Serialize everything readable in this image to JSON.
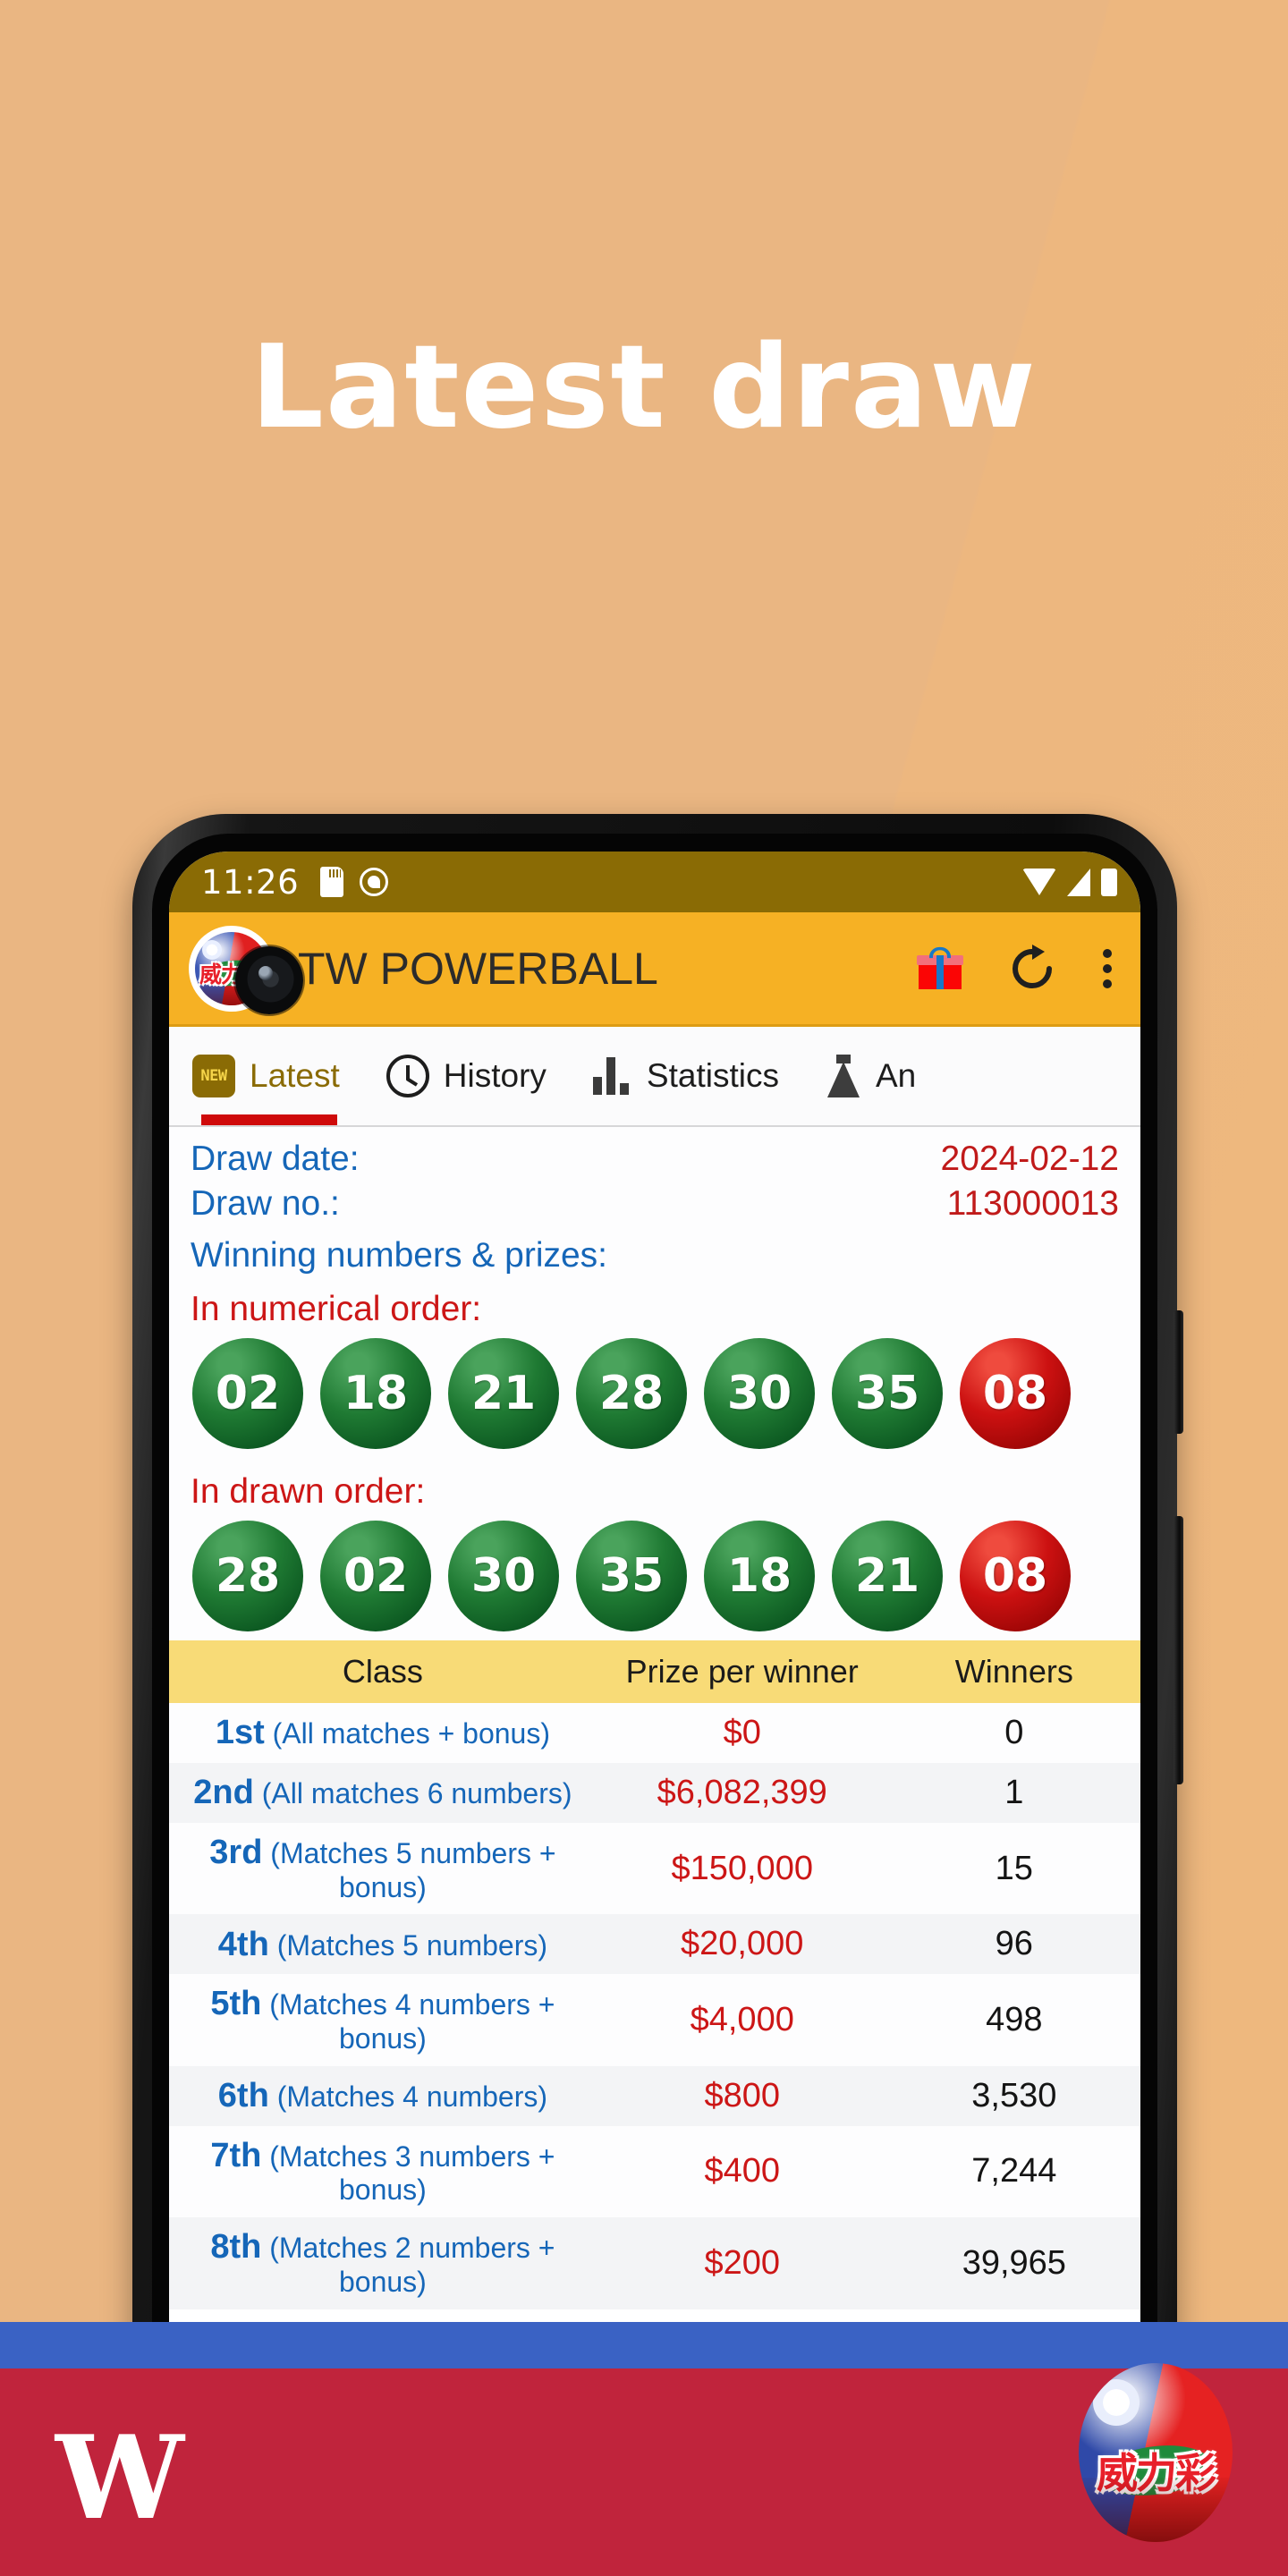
{
  "headline": "Latest draw",
  "phone": {
    "status_bar": {
      "time": "11:26",
      "icons": [
        "sd-card-icon",
        "do-not-disturb-icon",
        "wifi-icon",
        "signal-icon",
        "battery-icon"
      ]
    },
    "app_bar": {
      "title": "TW POWERBALL",
      "logo_chars": "威力彩",
      "actions": [
        "gift-icon",
        "refresh-icon",
        "overflow-menu-icon"
      ]
    },
    "tabs": [
      {
        "label": "Latest",
        "icon": "new-badge-icon",
        "badge": "NEW",
        "active": true
      },
      {
        "label": "History",
        "icon": "clock-icon",
        "active": false
      },
      {
        "label": "Statistics",
        "icon": "bar-chart-icon",
        "active": false
      },
      {
        "label": "An",
        "icon": "flask-icon",
        "active": false
      }
    ],
    "draw_info": {
      "date_label": "Draw date:",
      "date_value": "2024-02-12",
      "no_label": "Draw no.:",
      "no_value": "113000013",
      "winning_header": "Winning numbers & prizes:",
      "numerical_label": "In numerical order:",
      "drawn_label": "In drawn order:",
      "numerical_order": [
        {
          "n": "02",
          "type": "green"
        },
        {
          "n": "18",
          "type": "green"
        },
        {
          "n": "21",
          "type": "green"
        },
        {
          "n": "28",
          "type": "green"
        },
        {
          "n": "30",
          "type": "green"
        },
        {
          "n": "35",
          "type": "green"
        },
        {
          "n": "08",
          "type": "red"
        }
      ],
      "drawn_order": [
        {
          "n": "28",
          "type": "green"
        },
        {
          "n": "02",
          "type": "green"
        },
        {
          "n": "30",
          "type": "green"
        },
        {
          "n": "35",
          "type": "green"
        },
        {
          "n": "18",
          "type": "green"
        },
        {
          "n": "21",
          "type": "green"
        },
        {
          "n": "08",
          "type": "red"
        }
      ]
    },
    "prize_table": {
      "headers": [
        "Class",
        "Prize per winner",
        "Winners"
      ],
      "rows": [
        {
          "rank": "1st",
          "desc": "(All matches + bonus)",
          "prize": "$0",
          "winners": "0"
        },
        {
          "rank": "2nd",
          "desc": "(All matches 6 numbers)",
          "prize": "$6,082,399",
          "winners": "1"
        },
        {
          "rank": "3rd",
          "desc": "(Matches 5 numbers + bonus)",
          "prize": "$150,000",
          "winners": "15"
        },
        {
          "rank": "4th",
          "desc": "(Matches 5 numbers)",
          "prize": "$20,000",
          "winners": "96"
        },
        {
          "rank": "5th",
          "desc": "(Matches 4 numbers + bonus)",
          "prize": "$4,000",
          "winners": "498"
        },
        {
          "rank": "6th",
          "desc": "(Matches 4 numbers)",
          "prize": "$800",
          "winners": "3,530"
        },
        {
          "rank": "7th",
          "desc": "(Matches 3 numbers + bonus)",
          "prize": "$400",
          "winners": "7,244"
        },
        {
          "rank": "8th",
          "desc": "(Matches 2 numbers + bonus)",
          "prize": "$200",
          "winners": "39,965"
        }
      ]
    }
  },
  "banner": {
    "w_logo": "W",
    "ball_chars": "威力彩"
  },
  "colors": {
    "background": "#ecb57e",
    "app_bar": "#f6b124",
    "status_bar": "#8a6b05",
    "tab_indicator": "#cf0a0a",
    "label_blue": "#1566b8",
    "value_red": "#c01a1a",
    "table_header": "#f8db77",
    "banner_blue": "#3a62c4",
    "banner_red": "#c0243c",
    "ball_green": "#1f7a33",
    "ball_red": "#cc1111"
  }
}
